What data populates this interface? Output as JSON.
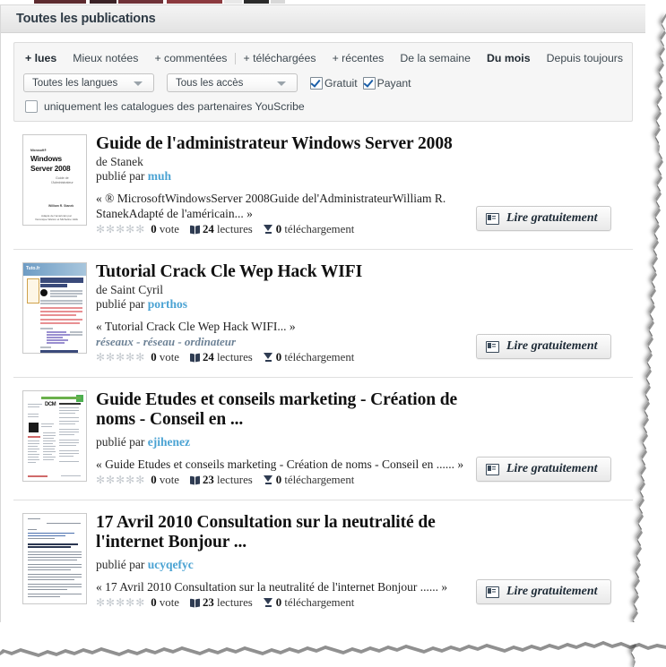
{
  "header": {
    "title": "Toutes les publications"
  },
  "filters": {
    "sort_options": [
      {
        "label": "+ lues",
        "active": true
      },
      {
        "label": "Mieux notées",
        "active": false
      },
      {
        "label": "+ commentées",
        "active": false
      },
      {
        "label": "+ téléchargées",
        "active": false
      },
      {
        "label": "+ récentes",
        "active": false
      },
      {
        "label": "De la semaine",
        "active": false
      },
      {
        "label": "Du mois",
        "active": true
      },
      {
        "label": "Depuis toujours",
        "active": false
      }
    ],
    "language_select": {
      "value": "Toutes les langues"
    },
    "access_select": {
      "value": "Tous les accès"
    },
    "checkboxes": [
      {
        "label": "Gratuit",
        "checked": true
      },
      {
        "label": "Payant",
        "checked": true
      }
    ],
    "partners_checkbox": {
      "label": "uniquement les catalogues des partenaires YouScribe",
      "checked": false
    }
  },
  "labels": {
    "published_by": "publié par",
    "vote_word": "vote",
    "reads_word": "lectures",
    "downloads_word": "téléchargement",
    "read_button": "Lire gratuitement",
    "stars": "✻✻✻✻✻"
  },
  "colors": {
    "link": "#4ba3d3",
    "tag": "#6d8296",
    "header_text": "#2f3b46",
    "panel_bg": "#f6f6f6"
  },
  "results": [
    {
      "title": "Guide de l'administrateur Windows Server 2008",
      "author": "de Stanek",
      "publisher": "muh",
      "description": "« ® MicrosoftWindowsServer 2008Guide del'AdministrateurWilliam R. StanekAdapté de l'américain... »",
      "tags": "",
      "votes": "0",
      "reads": "24",
      "downloads": "0",
      "thumb": "windows-server-2008-cover"
    },
    {
      "title": "Tutorial Crack Cle Wep Hack WIFI",
      "author": "de Saint Cyril",
      "publisher": "porthos",
      "description": "« Tutorial Crack Cle Wep Hack WIFI... »",
      "tags": "réseaux - réseau - ordinateur",
      "votes": "0",
      "reads": "24",
      "downloads": "0",
      "thumb": "tutorial-page"
    },
    {
      "title": "Guide Etudes et conseils marketing - Création de noms - Conseil en ...",
      "author": "",
      "publisher": "ejihenez",
      "description": "« Guide Etudes et conseils marketing - Création de noms - Conseil en ...... »",
      "tags": "",
      "votes": "0",
      "reads": "23",
      "downloads": "0",
      "thumb": "marketing-guide-page"
    },
    {
      "title": "17 Avril 2010 Consultation sur la neutralité de l'internet Bonjour ...",
      "author": "",
      "publisher": "ucyqefyc",
      "description": "« 17 Avril 2010 Consultation sur la neutralité de l'internet Bonjour ...... »",
      "tags": "",
      "votes": "0",
      "reads": "23",
      "downloads": "0",
      "thumb": "text-document-page"
    }
  ]
}
